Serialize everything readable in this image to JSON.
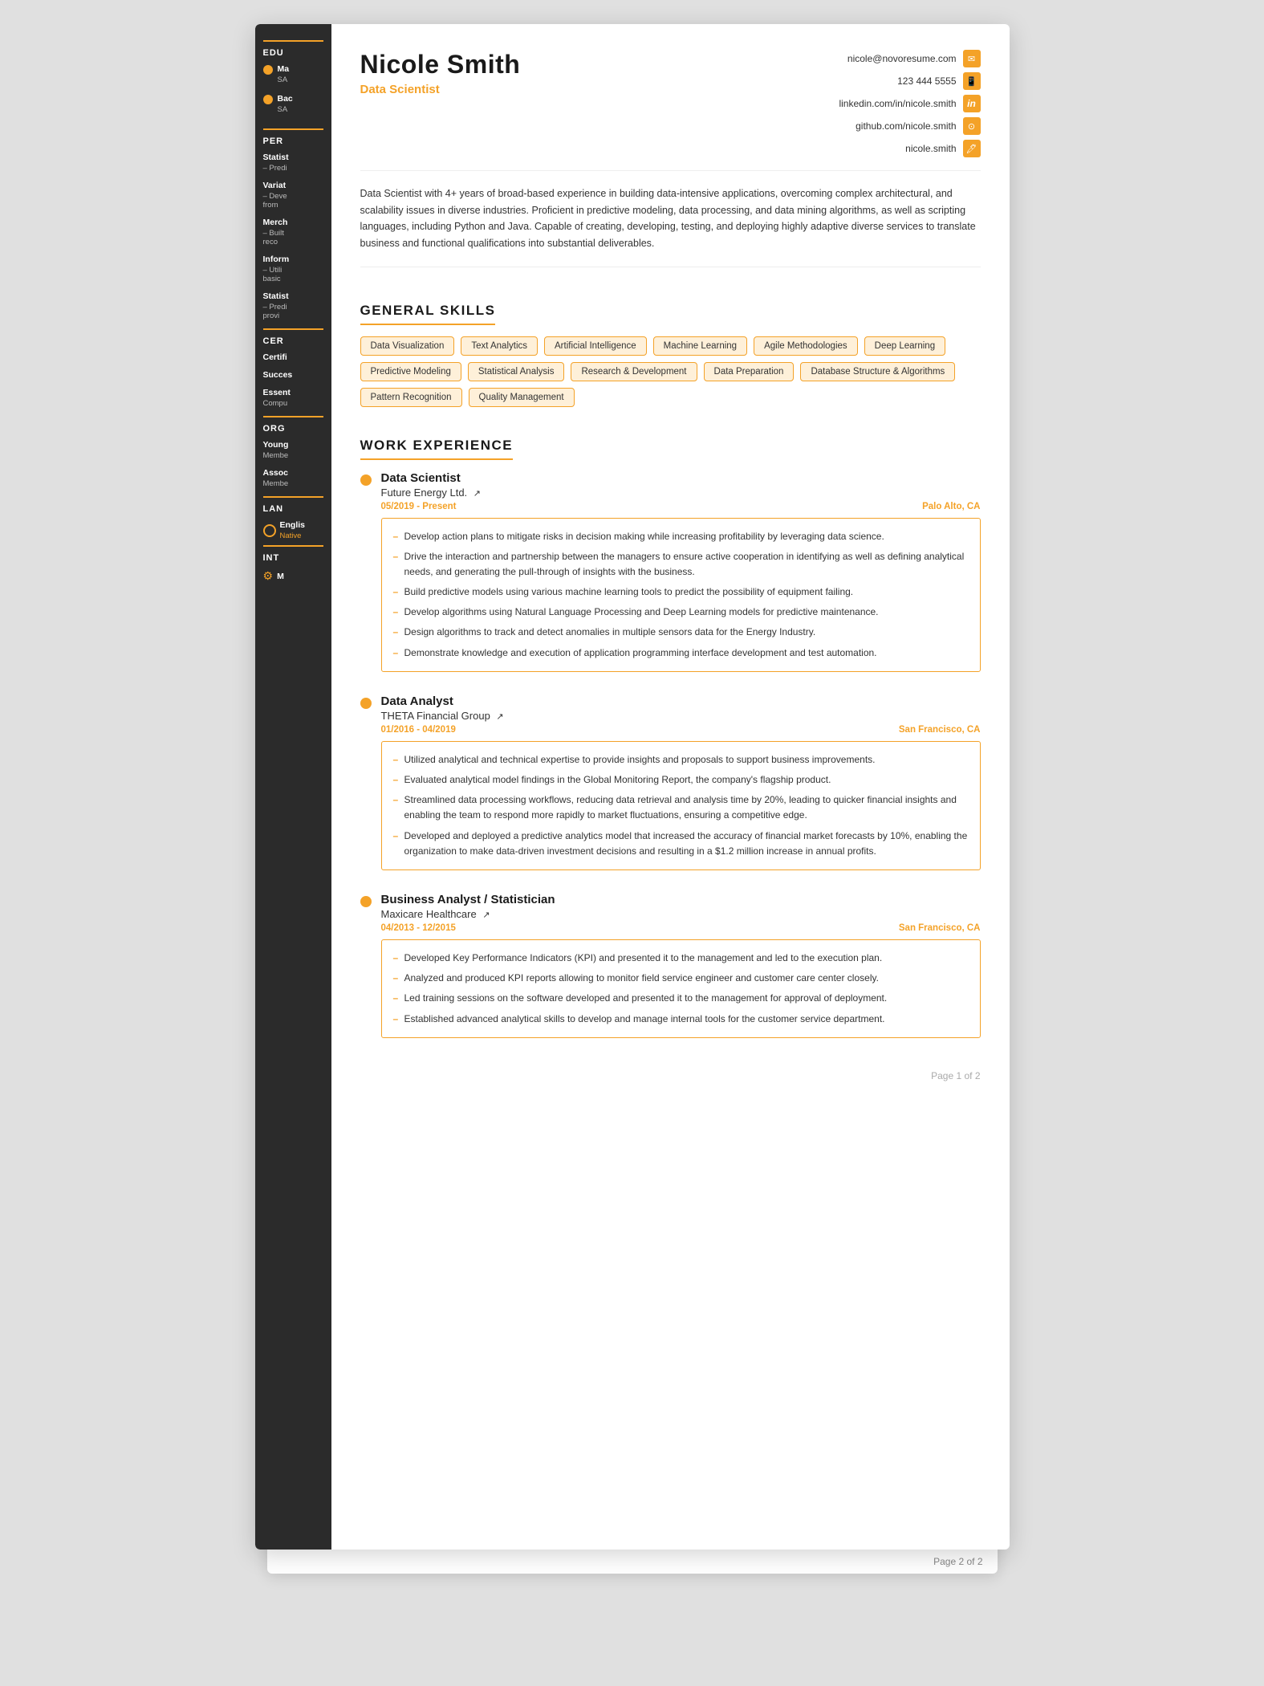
{
  "page": {
    "page_number": "Page 1 of 2",
    "page_bg_label": "Page 2 of 2"
  },
  "header": {
    "name": "Nicole Smith",
    "subtitle": "Data Scientist",
    "contact": [
      {
        "text": "nicole@novoresume.com",
        "icon": "✉",
        "name": "email"
      },
      {
        "text": "123 444 5555",
        "icon": "📱",
        "name": "phone"
      },
      {
        "text": "linkedin.com/in/nicole.smith",
        "icon": "in",
        "name": "linkedin"
      },
      {
        "text": "github.com/nicole.smith",
        "icon": "⊙",
        "name": "github"
      },
      {
        "text": "nicole.smith",
        "icon": "🖊",
        "name": "portfolio"
      }
    ]
  },
  "summary": "Data Scientist with 4+ years of broad-based experience in building data-intensive applications, overcoming complex architectural, and scalability issues in diverse industries. Proficient in predictive modeling, data processing, and data mining algorithms, as well as scripting languages, including Python and Java. Capable of creating, developing, testing, and deploying highly adaptive diverse services to translate business and functional qualifications into substantial deliverables.",
  "skills_section_title": "GENERAL SKILLS",
  "skills": [
    "Data Visualization",
    "Text Analytics",
    "Artificial Intelligence",
    "Machine Learning",
    "Agile Methodologies",
    "Deep Learning",
    "Predictive Modeling",
    "Statistical Analysis",
    "Research & Development",
    "Data Preparation",
    "Database Structure & Algorithms",
    "Pattern Recognition",
    "Quality Management"
  ],
  "work_section_title": "WORK EXPERIENCE",
  "work": [
    {
      "title": "Data Scientist",
      "company": "Future Energy Ltd.",
      "company_link": "↗",
      "date": "05/2019 - Present",
      "location": "Palo Alto, CA",
      "bullets": [
        "Develop action plans to mitigate risks in decision making while increasing profitability by leveraging data science.",
        "Drive the interaction and partnership between the managers to ensure active cooperation in identifying as well as defining analytical needs, and generating the pull-through of insights with the business.",
        "Build predictive models using various machine learning tools to predict the possibility of equipment failing.",
        "Develop algorithms using Natural Language Processing and Deep Learning models for predictive maintenance.",
        "Design algorithms to track and detect anomalies in multiple sensors data for the Energy Industry.",
        "Demonstrate knowledge and execution of application programming interface development and test automation."
      ]
    },
    {
      "title": "Data Analyst",
      "company": "THETA Financial Group",
      "company_link": "↗",
      "date": "01/2016 - 04/2019",
      "location": "San Francisco, CA",
      "bullets": [
        "Utilized analytical and technical expertise to provide insights and proposals to support business improvements.",
        "Evaluated analytical model findings in the Global Monitoring Report, the company's flagship product.",
        "Streamlined data processing workflows, reducing data retrieval and analysis time by 20%, leading to quicker financial insights and enabling the team to respond more rapidly to market fluctuations, ensuring a competitive edge.",
        "Developed and deployed a predictive analytics model that increased the accuracy of financial market forecasts by 10%, enabling the organization to make data-driven investment decisions and resulting in a $1.2 million increase in annual profits."
      ]
    },
    {
      "title": "Business Analyst / Statistician",
      "company": "Maxicare Healthcare",
      "company_link": "↗",
      "date": "04/2013 - 12/2015",
      "location": "San Francisco, CA",
      "bullets": [
        "Developed Key Performance Indicators (KPI) and presented it to the management and led to the execution plan.",
        "Analyzed and produced KPI reports allowing to monitor field service engineer and customer care center closely.",
        "Led training sessions on the software developed and presented it to the management for approval of deployment.",
        "Established advanced analytical skills to develop and manage internal tools for the customer service department."
      ]
    }
  ],
  "sidebar": {
    "edu_title": "EDU",
    "edu_items": [
      {
        "name": "Ma",
        "sub": "SA"
      },
      {
        "name": "Bac",
        "sub": "SA"
      }
    ],
    "per_title": "PER",
    "per_items": [
      {
        "name": "Statist",
        "sub": "– Predi"
      },
      {
        "name": "Variat",
        "sub": "– Deve\nfrom"
      },
      {
        "name": "Merch",
        "sub": "– Built\nreco"
      },
      {
        "name": "Inform",
        "sub": "– Utili\nbasic"
      },
      {
        "name": "Statist",
        "sub": "– Predi\nprovi"
      }
    ],
    "cer_title": "CER",
    "cer_items": [
      {
        "name": "Certifi"
      },
      {
        "name": "Succes"
      },
      {
        "name": "Essent",
        "sub": "Compu"
      }
    ],
    "org_title": "ORG",
    "org_items": [
      {
        "name": "Young",
        "sub": "Membe"
      },
      {
        "name": "Assoc",
        "sub": "Membe"
      }
    ],
    "lan_title": "LAN",
    "lan_items": [
      {
        "name": "Englis",
        "sub": "Native"
      }
    ],
    "int_title": "INT",
    "int_items": [
      {
        "name": "M"
      }
    ]
  }
}
